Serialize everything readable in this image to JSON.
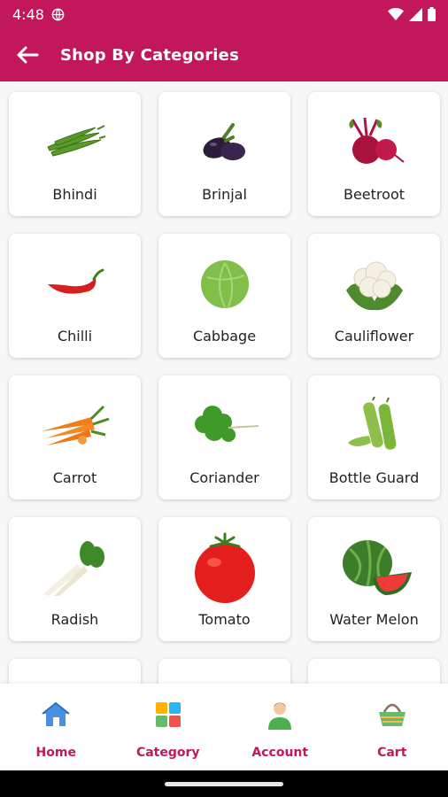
{
  "status": {
    "time": "4:48"
  },
  "header": {
    "title": "Shop By Categories"
  },
  "categories": [
    {
      "label": "Bhindi",
      "icon": "okra-icon"
    },
    {
      "label": "Brinjal",
      "icon": "eggplant-icon"
    },
    {
      "label": "Beetroot",
      "icon": "beetroot-icon"
    },
    {
      "label": "Chilli",
      "icon": "chilli-icon"
    },
    {
      "label": "Cabbage",
      "icon": "cabbage-icon"
    },
    {
      "label": "Cauliflower",
      "icon": "cauliflower-icon"
    },
    {
      "label": "Carrot",
      "icon": "carrot-icon"
    },
    {
      "label": "Coriander",
      "icon": "coriander-icon"
    },
    {
      "label": "Bottle Guard",
      "icon": "bottle-gourd-icon"
    },
    {
      "label": "Radish",
      "icon": "radish-icon"
    },
    {
      "label": "Tomato",
      "icon": "tomato-icon"
    },
    {
      "label": "Water Melon",
      "icon": "watermelon-icon"
    }
  ],
  "bottom_nav": [
    {
      "label": "Home",
      "icon": "home-icon"
    },
    {
      "label": "Category",
      "icon": "category-grid-icon"
    },
    {
      "label": "Account",
      "icon": "account-icon"
    },
    {
      "label": "Cart",
      "icon": "cart-basket-icon"
    }
  ],
  "colors": {
    "primary": "#c2185b",
    "background": "#f7f7f7"
  }
}
